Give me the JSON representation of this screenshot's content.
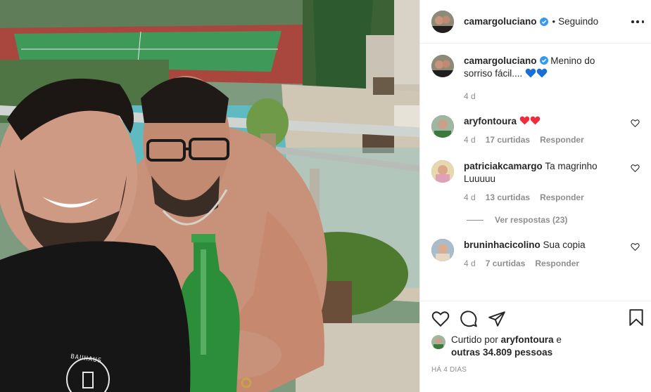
{
  "header": {
    "username": "camargoluciano",
    "separator": "•",
    "follow_status": "Seguindo"
  },
  "caption": {
    "username": "camargoluciano",
    "text": "Menino do sorriso fácil....",
    "time": "4 d"
  },
  "comments": [
    {
      "username": "aryfontoura",
      "text": "",
      "time": "4 d",
      "likes": "17 curtidas",
      "reply": "Responder"
    },
    {
      "username": "patriciakcamargo",
      "text": "Ta magrinho Luuuuu",
      "time": "4 d",
      "likes": "13 curtidas",
      "reply": "Responder"
    },
    {
      "username": "bruninhacicolino",
      "text": "Sua copia",
      "time": "4 d",
      "likes": "7 curtidas",
      "reply": "Responder"
    }
  ],
  "view_replies": "Ver respostas (23)",
  "likes_summary": {
    "prefix": "Curtido por",
    "user": "aryfontoura",
    "connector": "e",
    "others": "outras 34.809 pessoas"
  },
  "date": "HÁ 4 DIAS",
  "photo": {
    "shirt_text": "BAUHAUS"
  },
  "icons": {
    "like": "heart-icon",
    "comment": "comment-icon",
    "share": "paper-plane-icon",
    "save": "bookmark-icon",
    "more": "more-options-icon",
    "verified": "verified-badge-icon"
  },
  "colors": {
    "verified_blue": "#3897f0",
    "heart_red": "#ed4956",
    "heart_blue": "#1a6fd6",
    "muted_text": "#8e8e8e"
  }
}
